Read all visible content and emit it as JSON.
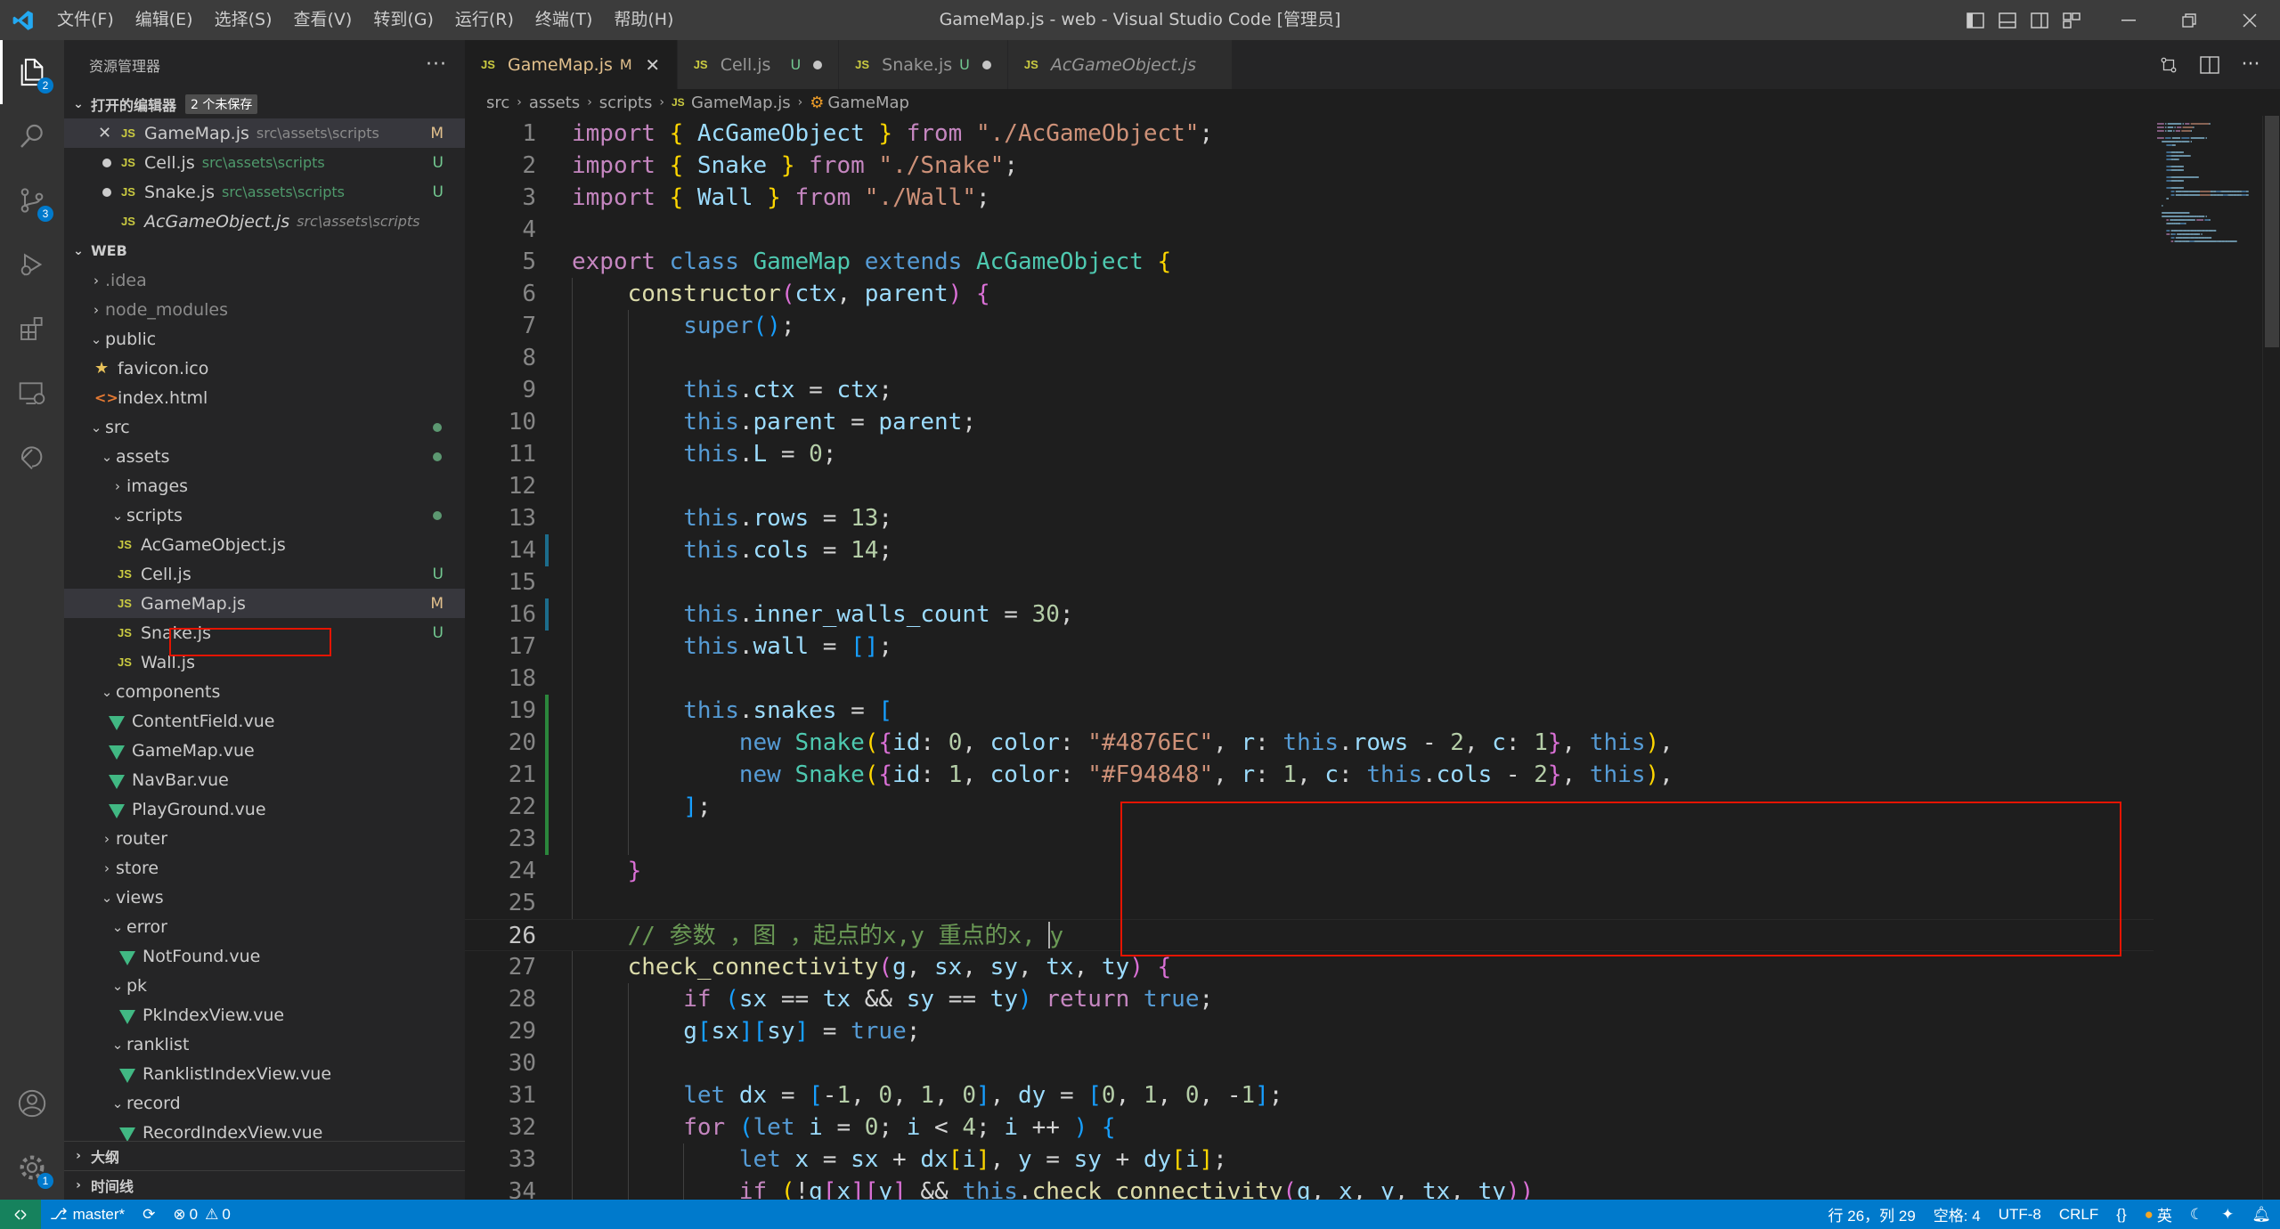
{
  "titlebar": {
    "title": "GameMap.js - web - Visual Studio Code [管理员]",
    "menu": [
      "文件(F)",
      "编辑(E)",
      "选择(S)",
      "查看(V)",
      "转到(G)",
      "运行(R)",
      "终端(T)",
      "帮助(H)"
    ]
  },
  "activity": {
    "explorer_badge": "2",
    "scm_badge": "3",
    "settings_badge": "1"
  },
  "sidebar": {
    "header": "资源管理器",
    "more": "···",
    "open_editors": {
      "label": "打开的编辑器",
      "badge": "2 个未保存"
    },
    "open_files": [
      {
        "name": "GameMap.js",
        "path": "src\\assets\\scripts",
        "status": "M"
      },
      {
        "name": "Cell.js",
        "path": "src\\assets\\scripts",
        "status": "U"
      },
      {
        "name": "Snake.js",
        "path": "src\\assets\\scripts",
        "status": "U"
      },
      {
        "name": "AcGameObject.js",
        "path": "src\\assets\\scripts",
        "status": ""
      }
    ],
    "workspace": "WEB",
    "tree": {
      "idea": ".idea",
      "node_modules": "node_modules",
      "public": "public",
      "favicon": "favicon.ico",
      "index": "index.html",
      "src": "src",
      "assets": "assets",
      "images": "images",
      "scripts": "scripts",
      "acgame": "AcGameObject.js",
      "cell": "Cell.js",
      "cell_status": "U",
      "gamemap": "GameMap.js",
      "gamemap_status": "M",
      "snake": "Snake.js",
      "snake_status": "U",
      "wall": "Wall.js",
      "components": "components",
      "contentfield": "ContentField.vue",
      "gamemapvue": "GameMap.vue",
      "navbar": "NavBar.vue",
      "playground": "PlayGround.vue",
      "router": "router",
      "store": "store",
      "views": "views",
      "error": "error",
      "notfound": "NotFound.vue",
      "pk": "pk",
      "pkindex": "PkIndexView.vue",
      "ranklist": "ranklist",
      "ranklistindex": "RanklistIndexView.vue",
      "record": "record",
      "recordindex": "RecordIndexView.vue"
    },
    "outline": "大纲",
    "timeline": "时间线"
  },
  "tabs": [
    {
      "name": "GameMap.js",
      "badge": "M"
    },
    {
      "name": "Cell.js",
      "badge": "U"
    },
    {
      "name": "Snake.js",
      "badge": "U"
    },
    {
      "name": "AcGameObject.js",
      "badge": ""
    }
  ],
  "breadcrumb": [
    "src",
    "assets",
    "scripts",
    "GameMap.js",
    "GameMap"
  ],
  "editor": {
    "line_numbers": [
      "1",
      "2",
      "3",
      "4",
      "5",
      "6",
      "7",
      "8",
      "9",
      "10",
      "11",
      "12",
      "13",
      "14",
      "15",
      "16",
      "17",
      "18",
      "19",
      "20",
      "21",
      "22",
      "23",
      "24",
      "25",
      "26",
      "27",
      "28",
      "29",
      "30",
      "31",
      "32",
      "33",
      "34"
    ],
    "current_line": "26"
  },
  "status": {
    "branch": "master*",
    "errors": "0",
    "warnings": "0",
    "position": "行 26，列 29",
    "spaces": "空格: 4",
    "encoding": "UTF-8",
    "eol": "CRLF",
    "lang": "{}",
    "ime": "英"
  },
  "colors": {
    "accent": "#007acc",
    "modified": "#e2c08d",
    "untracked": "#73c991",
    "highlight_box": "#e51400"
  }
}
